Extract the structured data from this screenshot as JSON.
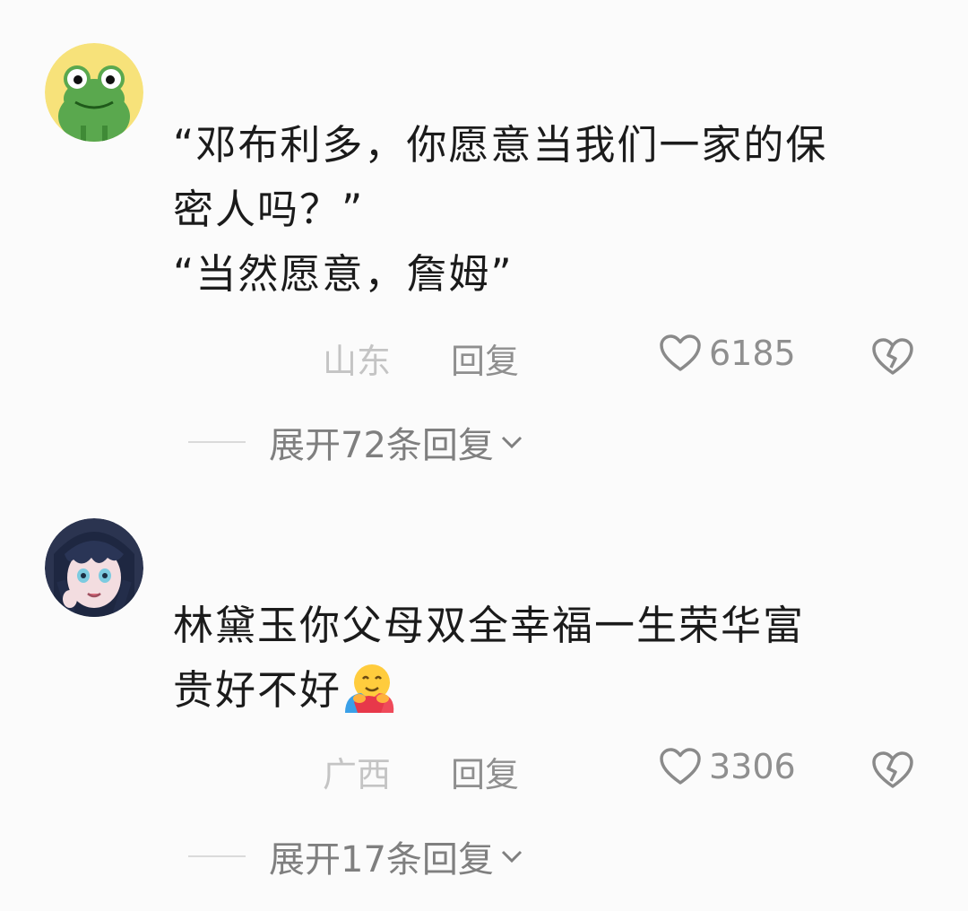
{
  "comments": [
    {
      "avatar_icon": "frog-avatar-icon",
      "lines": [
        "“邓布利多，你愿意当我们一家的保",
        "密人吗？”",
        "“当然愿意，詹姆”"
      ],
      "location": "山东",
      "reply_label": "回复",
      "like_icon": "heart-outline-icon",
      "like_count": "6185",
      "dislike_icon": "broken-heart-icon",
      "expand_label": "展开72条回复",
      "expand_icon": "chevron-down-icon"
    },
    {
      "avatar_icon": "anime-girl-avatar-icon",
      "lines": [
        "林黛玉你父母双全幸福一生荣华富",
        "贵好不好"
      ],
      "emoji": "hugging-emoji",
      "location": "广西",
      "reply_label": "回复",
      "like_icon": "heart-outline-icon",
      "like_count": "3306",
      "dislike_icon": "broken-heart-icon",
      "expand_label": "展开17条回复",
      "expand_icon": "chevron-down-icon"
    }
  ],
  "colors": {
    "background": "#fbfbfb",
    "text": "#1b1b1b",
    "meta_text": "#8f8f8f",
    "location_text": "#c4c4c4",
    "frog_bg": "#f7e27a",
    "frog_green": "#5aa84e"
  }
}
